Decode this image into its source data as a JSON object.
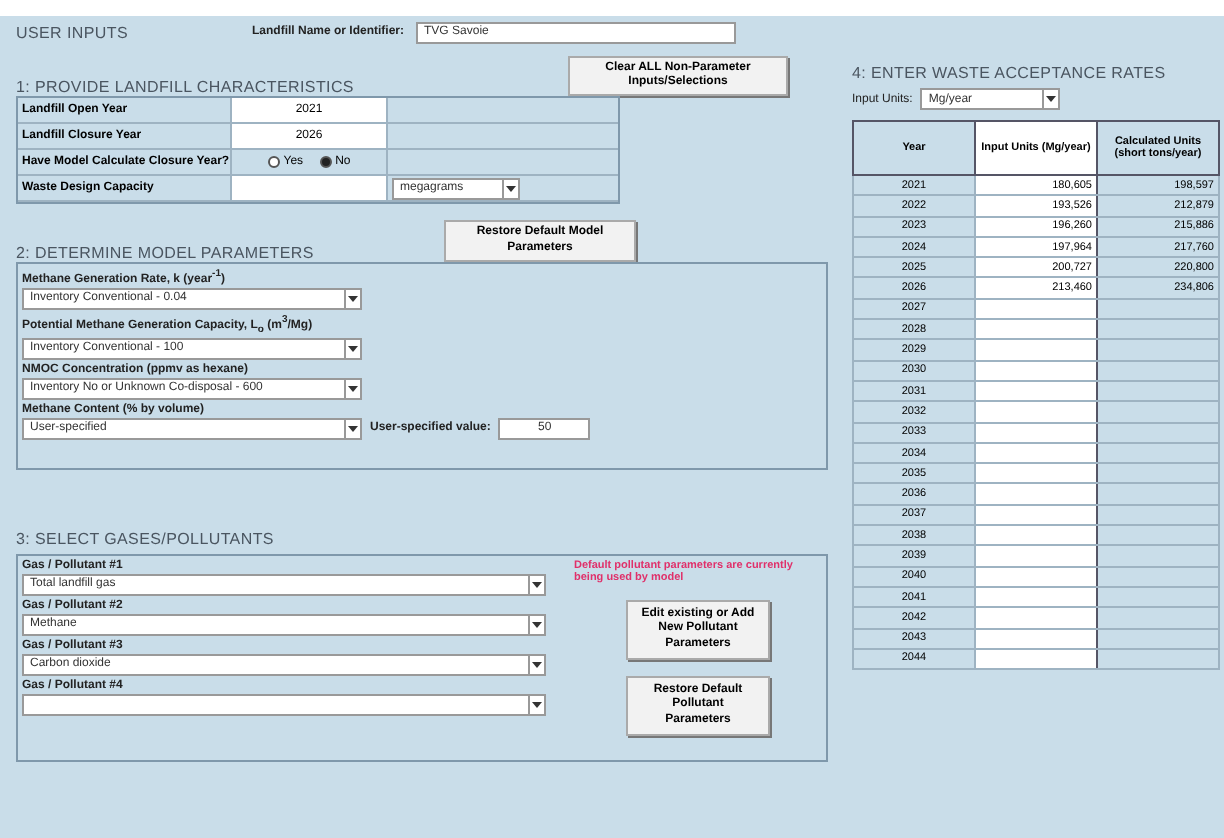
{
  "header": {
    "title": "USER INPUTS",
    "name_label": "Landfill Name or Identifier:",
    "name_value": "TVG Savoie"
  },
  "clear_button": "Clear ALL Non-Parameter Inputs/Selections",
  "section1": {
    "title": "1: PROVIDE LANDFILL CHARACTERISTICS",
    "rows": [
      {
        "kind": "value",
        "label": "Landfill Open Year",
        "value": "2021"
      },
      {
        "kind": "value",
        "label": "Landfill Closure Year",
        "value": "2026"
      },
      {
        "kind": "radio",
        "label": "Have Model Calculate Closure Year?",
        "options": [
          {
            "label": "Yes",
            "selected": false
          },
          {
            "label": "No",
            "selected": true
          }
        ]
      },
      {
        "kind": "select",
        "label": "Waste Design Capacity",
        "value": "megagrams"
      }
    ]
  },
  "restore_model_button": "Restore Default Model Parameters",
  "section2": {
    "title": "2: DETERMINE MODEL PARAMETERS",
    "params": [
      {
        "label": "Methane Generation Rate, k (year$^{-1}$)",
        "value": "Inventory Conventional - 0.04"
      },
      {
        "label": "Potential Methane Generation Capacity, L$_{o}$ (m$^{3}$/Mg)",
        "value": "Inventory Conventional - 100"
      },
      {
        "label": "NMOC Concentration (ppmv as hexane)",
        "value": "Inventory No or Unknown Co-disposal - 600"
      },
      {
        "label": "Methane Content (% by volume)",
        "value": "User-specified",
        "extra_label": "User-specified value:",
        "extra_value": "50"
      }
    ]
  },
  "section3": {
    "title": "3: SELECT GASES/POLLUTANTS",
    "note": "Default pollutant parameters are currently being used by model",
    "pollutants": [
      {
        "label": "Gas / Pollutant #1",
        "value": "Total landfill gas"
      },
      {
        "label": "Gas / Pollutant #2",
        "value": "Methane"
      },
      {
        "label": "Gas / Pollutant #3",
        "value": "Carbon dioxide"
      },
      {
        "label": "Gas / Pollutant #4"
      }
    ],
    "buttons": [
      "Edit existing or Add New Pollutant Parameters",
      "Restore Default Pollutant Parameters"
    ]
  },
  "section4": {
    "title": "4: ENTER WASTE ACCEPTANCE RATES",
    "units_label": "Input Units:",
    "units_value": "Mg/year",
    "columns": [
      "Year",
      "Input Units (Mg/year)",
      "Calculated Units (short tons/year)"
    ],
    "rows": [
      [
        "2021",
        "180,605",
        "198,597"
      ],
      [
        "2022",
        "193,526",
        "212,879"
      ],
      [
        "2023",
        "196,260",
        "215,886"
      ],
      [
        "2024",
        "197,964",
        "217,760"
      ],
      [
        "2025",
        "200,727",
        "220,800"
      ],
      [
        "2026",
        "213,460",
        "234,806"
      ],
      [
        "2027"
      ],
      [
        "2028"
      ],
      [
        "2029"
      ],
      [
        "2030"
      ],
      [
        "2031"
      ],
      [
        "2032"
      ],
      [
        "2033"
      ],
      [
        "2034"
      ],
      [
        "2035"
      ],
      [
        "2036"
      ],
      [
        "2037"
      ],
      [
        "2038"
      ],
      [
        "2039"
      ],
      [
        "2040"
      ],
      [
        "2041"
      ],
      [
        "2042"
      ],
      [
        "2043"
      ],
      [
        "2044"
      ]
    ]
  }
}
